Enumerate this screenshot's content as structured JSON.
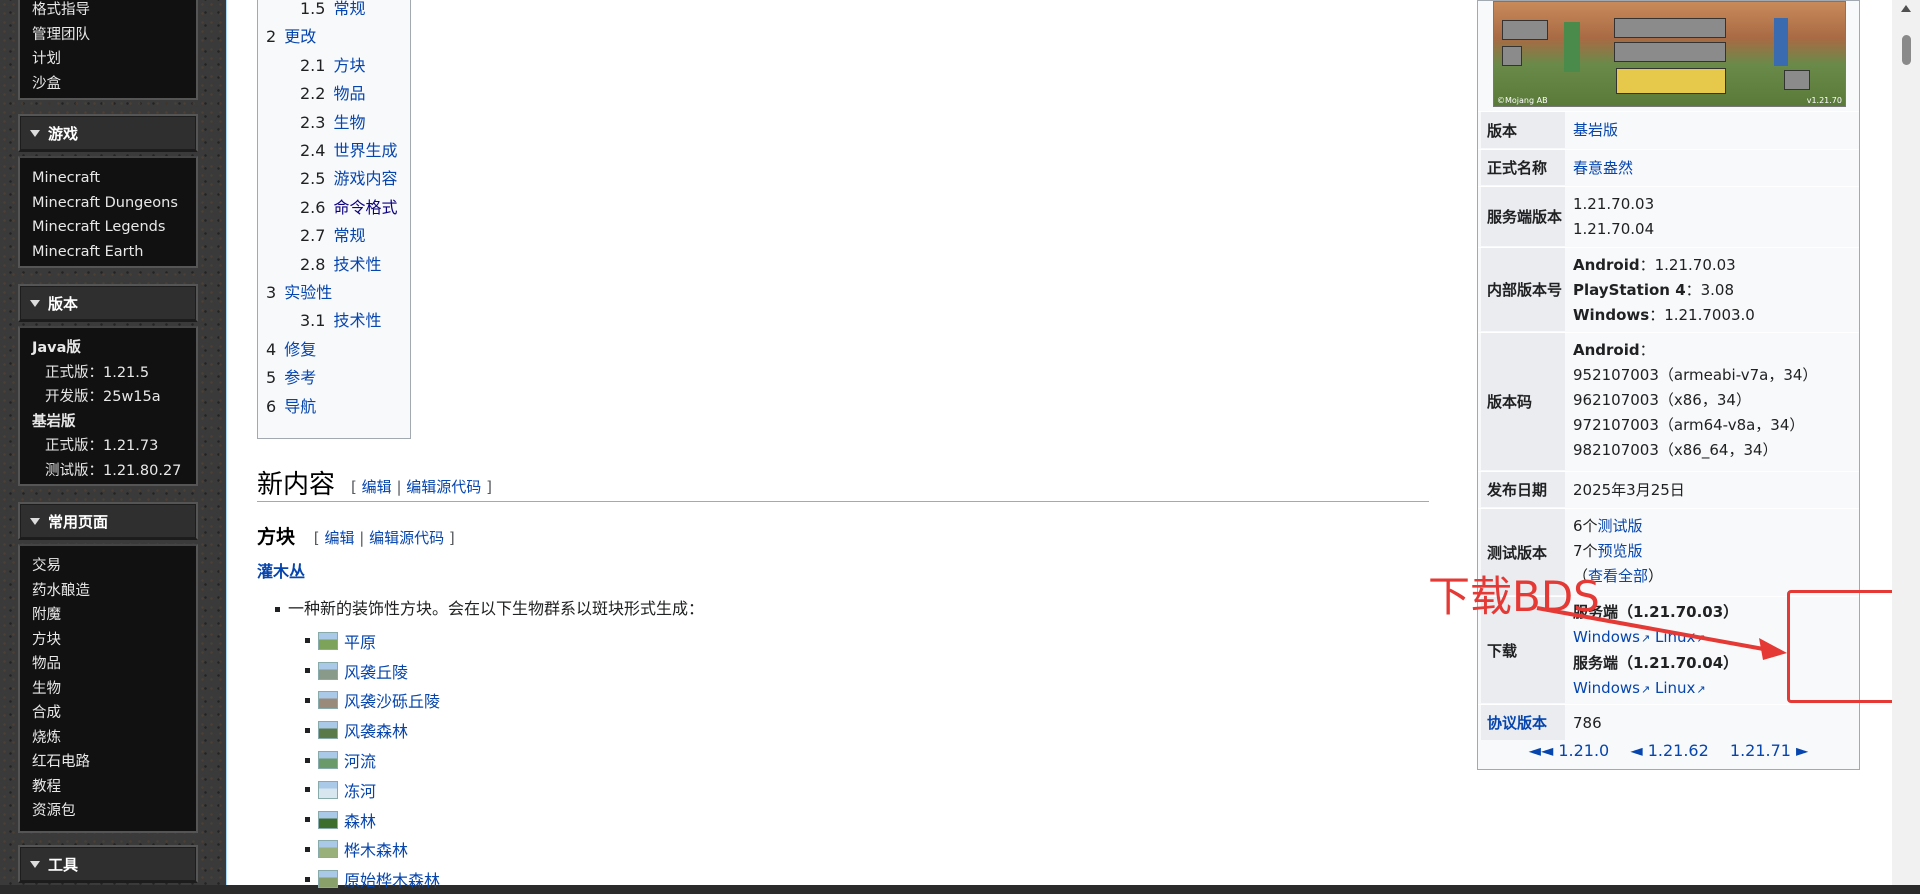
{
  "sidebar": {
    "top_items": [
      "格式指导",
      "管理团队",
      "计划",
      "沙盒"
    ],
    "games": {
      "title": "游戏",
      "items": [
        "Minecraft",
        "Minecraft Dungeons",
        "Minecraft Legends",
        "Minecraft Earth"
      ]
    },
    "versions": {
      "title": "版本",
      "java": "Java版",
      "java_release": "正式版：1.21.5",
      "java_snapshot": "开发版：25w15a",
      "bedrock": "基岩版",
      "bedrock_release": "正式版：1.21.73",
      "bedrock_beta": "测试版：1.21.80.27"
    },
    "common": {
      "title": "常用页面",
      "items": [
        "交易",
        "药水酿造",
        "附魔",
        "方块",
        "物品",
        "生物",
        "合成",
        "烧炼",
        "红石电路",
        "教程",
        "资源包"
      ]
    },
    "tools": {
      "title": "工具"
    }
  },
  "toc": [
    {
      "num": "1.5",
      "label": "常规",
      "indent": true
    },
    {
      "num": "2",
      "label": "更改",
      "indent": false
    },
    {
      "num": "2.1",
      "label": "方块",
      "indent": true
    },
    {
      "num": "2.2",
      "label": "物品",
      "indent": true
    },
    {
      "num": "2.3",
      "label": "生物",
      "indent": true
    },
    {
      "num": "2.4",
      "label": "世界生成",
      "indent": true
    },
    {
      "num": "2.5",
      "label": "游戏内容",
      "indent": true
    },
    {
      "num": "2.6",
      "label": "命令格式",
      "indent": true
    },
    {
      "num": "2.7",
      "label": "常规",
      "indent": true
    },
    {
      "num": "2.8",
      "label": "技术性",
      "indent": true
    },
    {
      "num": "3",
      "label": "实验性",
      "indent": false
    },
    {
      "num": "3.1",
      "label": "技术性",
      "indent": true
    },
    {
      "num": "4",
      "label": "修复",
      "indent": false
    },
    {
      "num": "5",
      "label": "参考",
      "indent": false
    },
    {
      "num": "6",
      "label": "导航",
      "indent": false
    }
  ],
  "content": {
    "section_new": "新内容",
    "section_blocks": "方块",
    "edit": "编辑",
    "edit_source": "编辑源代码",
    "sep": "|",
    "bracket_open": "[",
    "bracket_close": "]",
    "shrub": "灌木丛",
    "description": "一种新的装饰性方块。会在以下生物群系以斑块形式生成：",
    "biomes": [
      "平原",
      "风袭丘陵",
      "风袭沙砾丘陵",
      "风袭森林",
      "河流",
      "冻河",
      "森林",
      "桦木森林",
      "原始桦木森林"
    ]
  },
  "infobox": {
    "image_corner_left": "©Mojang AB",
    "image_corner_right": "v1.21.70",
    "rows": {
      "edition_label": "版本",
      "edition_value": "基岩版",
      "official_label": "正式名称",
      "official_value": "春意盎然",
      "server_label": "服务端版本",
      "server_v1": "1.21.70.03",
      "server_v2": "1.21.70.04",
      "internal_label": "内部版本号",
      "internal_android_k": "Android",
      "internal_android_v": "：1.21.70.03",
      "internal_ps4_k": "PlayStation 4",
      "internal_ps4_v": "：3.08",
      "internal_win_k": "Windows",
      "internal_win_v": "：1.21.7003.0",
      "code_label": "版本码",
      "code_android": "Android",
      "code_colon": "：",
      "code_1": "952107003（armeabi-v7a，34）",
      "code_2": "962107003（x86，34）",
      "code_3": "972107003（arm64-v8a，34）",
      "code_4": "982107003（x86_64，34）",
      "release_label": "发布日期",
      "release_value": "2025年3月25日",
      "test_label": "测试版本",
      "test_count1": "6个",
      "test_link1": "测试版",
      "test_count2": "7个",
      "test_link2": "预览版",
      "test_viewall_open": "（",
      "test_viewall": "查看全部",
      "test_viewall_close": "）",
      "download_label": "下载",
      "dl_server1": "服务端（1.21.70.03）",
      "dl_server2": "服务端（1.21.70.04）",
      "dl_windows": "Windows",
      "dl_linux": "Linux",
      "protocol_label": "协议版本",
      "protocol_value": "786"
    },
    "nav": {
      "prev_major": "◄◄ 1.21.0",
      "prev": "◄ 1.21.62",
      "next": "1.21.71 ►"
    }
  },
  "annotation": {
    "text": "下载BDS",
    "color": "#e53935"
  }
}
